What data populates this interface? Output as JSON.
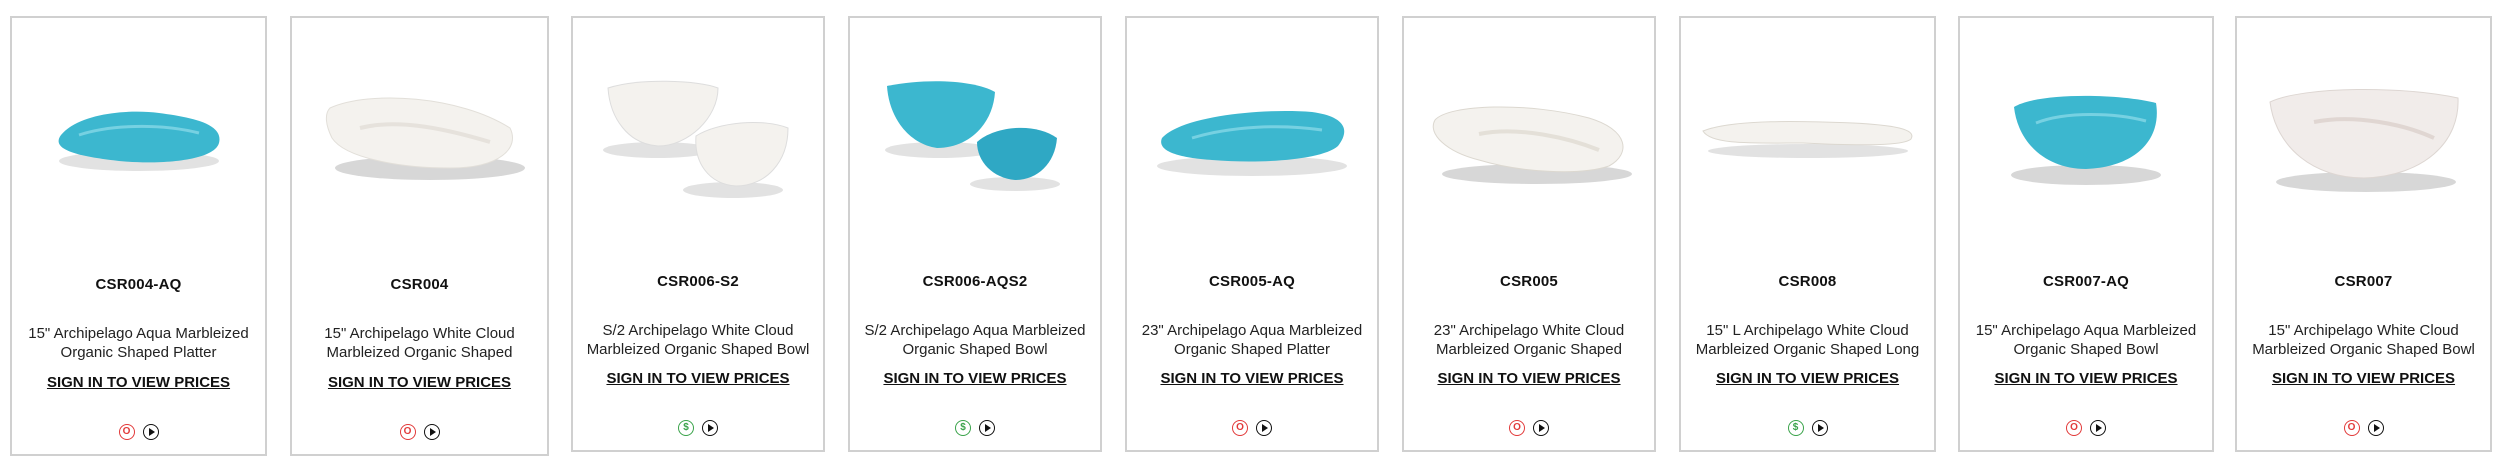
{
  "colors": {
    "aqua": "#3cb7cf",
    "white_cloud": "#f2f0ec",
    "unavailable_red": "#e23a3a",
    "available_green": "#3aa34a"
  },
  "products": [
    {
      "sku": "CSR004-AQ",
      "description": "15\" Archipelago Aqua Marbleized Organic Shaped Platter",
      "signin": "SIGN IN TO VIEW PRICES",
      "status_icon": "red-circle-icon",
      "status_glyph": "O"
    },
    {
      "sku": "CSR004",
      "description": "15\" Archipelago White Cloud Marbleized Organic Shaped",
      "signin": "SIGN IN TO VIEW PRICES",
      "status_icon": "red-circle-icon",
      "status_glyph": "O"
    },
    {
      "sku": "CSR006-S2",
      "description": "S/2 Archipelago White Cloud Marbleized Organic Shaped Bowl",
      "signin": "SIGN IN TO VIEW PRICES",
      "status_icon": "green-dollar-icon",
      "status_glyph": "$"
    },
    {
      "sku": "CSR006-AQS2",
      "description": "S/2 Archipelago Aqua Marbleized Organic Shaped Bowl",
      "signin": "SIGN IN TO VIEW PRICES",
      "status_icon": "green-dollar-icon",
      "status_glyph": "$"
    },
    {
      "sku": "CSR005-AQ",
      "description": "23\" Archipelago Aqua Marbleized Organic Shaped Platter",
      "signin": "SIGN IN TO VIEW PRICES",
      "status_icon": "red-circle-icon",
      "status_glyph": "O"
    },
    {
      "sku": "CSR005",
      "description": "23\" Archipelago White Cloud Marbleized Organic Shaped",
      "signin": "SIGN IN TO VIEW PRICES",
      "status_icon": "red-circle-icon",
      "status_glyph": "O"
    },
    {
      "sku": "CSR008",
      "description": "15\" L Archipelago White Cloud Marbleized Organic Shaped Long",
      "signin": "SIGN IN TO VIEW PRICES",
      "status_icon": "green-dollar-icon",
      "status_glyph": "$"
    },
    {
      "sku": "CSR007-AQ",
      "description": "15\" Archipelago Aqua Marbleized Organic Shaped Bowl",
      "signin": "SIGN IN TO VIEW PRICES",
      "status_icon": "red-circle-icon",
      "status_glyph": "O"
    },
    {
      "sku": "CSR007",
      "description": "15\" Archipelago White Cloud Marbleized Organic Shaped Bowl",
      "signin": "SIGN IN TO VIEW PRICES",
      "status_icon": "red-circle-icon",
      "status_glyph": "O"
    }
  ]
}
